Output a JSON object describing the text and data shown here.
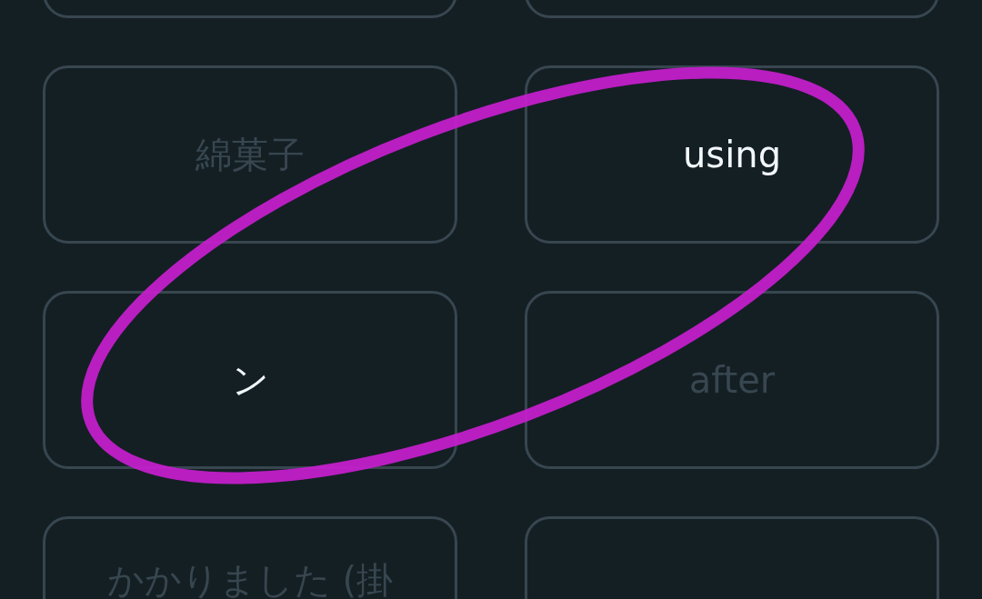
{
  "cards": [
    {
      "kind": "clipped_top"
    },
    {
      "kind": "clipped_top"
    },
    {
      "kind": "full",
      "label": "綿菓子",
      "disabled": true
    },
    {
      "kind": "full",
      "label": "using",
      "disabled": false
    },
    {
      "kind": "full",
      "label": "ン",
      "disabled": false
    },
    {
      "kind": "full",
      "label": "after",
      "disabled": true
    },
    {
      "kind": "clipped_bottom",
      "label": "かかりました (掛",
      "disabled": true
    },
    {
      "kind": "clipped_bottom"
    }
  ],
  "annotation": {
    "kind": "ellipse"
  }
}
